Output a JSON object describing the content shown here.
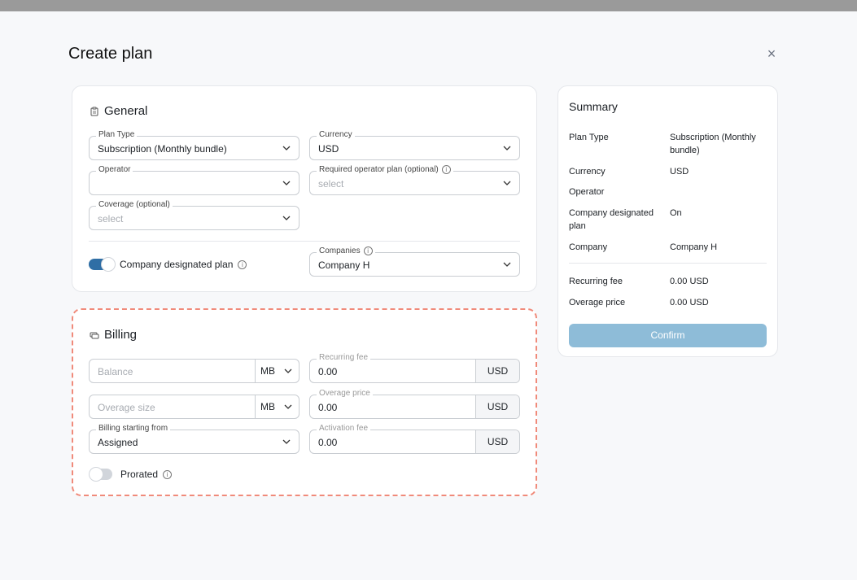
{
  "page": {
    "title": "Create plan",
    "close_label": "×"
  },
  "general": {
    "title": "General",
    "plan_type": {
      "label": "Plan Type",
      "value": "Subscription (Monthly bundle)"
    },
    "currency": {
      "label": "Currency",
      "value": "USD"
    },
    "operator": {
      "label": "Operator",
      "value": ""
    },
    "required_operator_plan": {
      "label": "Required operator plan (optional)",
      "placeholder": "select"
    },
    "coverage": {
      "label": "Coverage (optional)",
      "placeholder": "select"
    },
    "company_designated": {
      "label": "Company designated plan",
      "on": true
    },
    "companies": {
      "label": "Companies",
      "value": "Company H"
    }
  },
  "billing": {
    "title": "Billing",
    "balance": {
      "placeholder": "Balance",
      "unit": "MB"
    },
    "recurring_fee": {
      "label": "Recurring fee",
      "value": "0.00",
      "unit": "USD"
    },
    "overage_size": {
      "placeholder": "Overage size",
      "unit": "MB"
    },
    "overage_price": {
      "label": "Overage price",
      "value": "0.00",
      "unit": "USD"
    },
    "billing_start": {
      "label": "Billing starting from",
      "value": "Assigned"
    },
    "activation_fee": {
      "label": "Activation fee",
      "value": "0.00",
      "unit": "USD"
    },
    "prorated": {
      "label": "Prorated",
      "on": false
    }
  },
  "summary": {
    "title": "Summary",
    "rows": [
      {
        "key": "Plan Type",
        "value": "Subscription (Monthly bundle)"
      },
      {
        "key": "Currency",
        "value": "USD"
      },
      {
        "key": "Operator",
        "value": ""
      },
      {
        "key": "Company designated plan",
        "value": "On"
      },
      {
        "key": "Company",
        "value": "Company H"
      }
    ],
    "fees": [
      {
        "key": "Recurring fee",
        "value": "0.00 USD"
      },
      {
        "key": "Overage price",
        "value": "0.00 USD"
      }
    ],
    "confirm_label": "Confirm"
  }
}
